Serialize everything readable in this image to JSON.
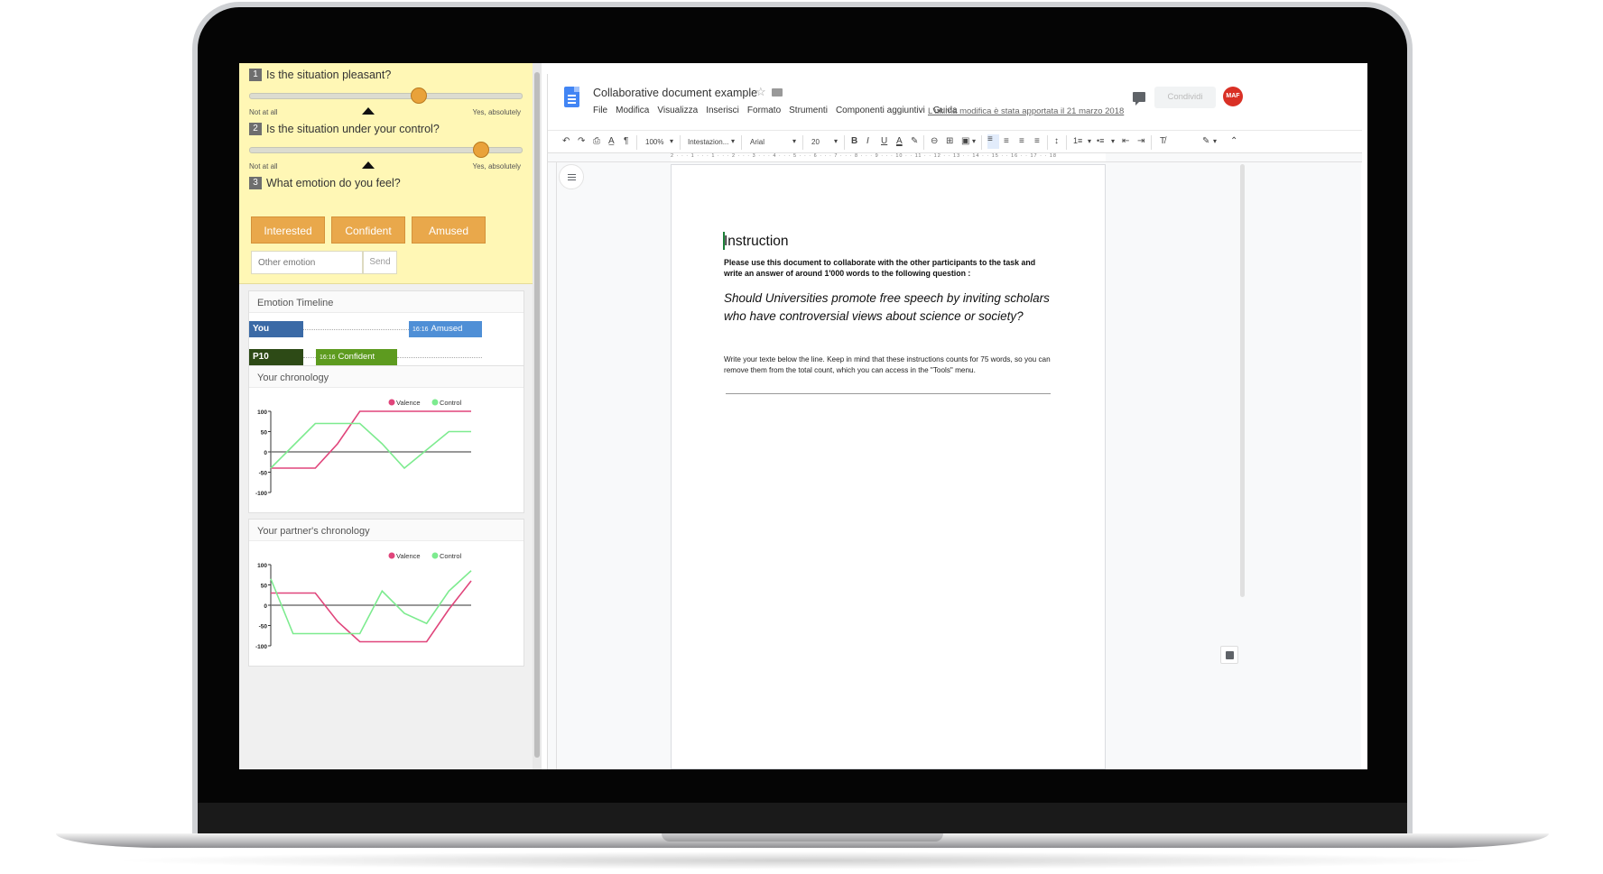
{
  "survey": {
    "q1": {
      "num": "1",
      "text": "Is the situation pleasant?",
      "min_label": "Not at all",
      "max_label": "Yes, absolutely",
      "value": 0.62
    },
    "q2": {
      "num": "2",
      "text": "Is the situation under your control?",
      "min_label": "Not at all",
      "max_label": "Yes, absolutely",
      "value": 0.85
    },
    "q3": {
      "num": "3",
      "text": "What emotion do you feel?"
    },
    "emotions": [
      "Interested",
      "Confident",
      "Amused"
    ],
    "other_placeholder": "Other emotion",
    "send_label": "Send"
  },
  "timeline": {
    "title": "Emotion Timeline",
    "rows": [
      {
        "participant": "You",
        "time": "16:16",
        "emotion": "Amused",
        "color": "#3b6aa6",
        "tag_color": "#4f8fd6"
      },
      {
        "participant": "P10",
        "time": "16:16",
        "emotion": "Confident",
        "color": "#2d4a16",
        "tag_color": "#5d9b1f"
      }
    ],
    "scroll_left": "◀",
    "scroll_right": "▶"
  },
  "charts": {
    "own_title": "Your chronology",
    "partner_title": "Your partner's chronology",
    "valence_color": "#e0457b",
    "control_color": "#7deb8f"
  },
  "chart_data": [
    {
      "type": "line",
      "title": "Your chronology",
      "ylim": [
        -100,
        100
      ],
      "yticks": [
        "100",
        "50",
        "0",
        "-50",
        "-100"
      ],
      "x": [
        0,
        1,
        2,
        3,
        4,
        5,
        6,
        7,
        8,
        9
      ],
      "series": [
        {
          "name": "Valence",
          "values": [
            -40,
            -40,
            -40,
            20,
            100,
            100,
            100,
            100,
            100,
            100
          ]
        },
        {
          "name": "Control",
          "values": [
            -40,
            15,
            70,
            70,
            70,
            20,
            -40,
            5,
            50,
            50
          ]
        }
      ]
    },
    {
      "type": "line",
      "title": "Your partner's chronology",
      "ylim": [
        -100,
        100
      ],
      "yticks": [
        "100",
        "50",
        "0",
        "-50",
        "-100"
      ],
      "x": [
        0,
        1,
        2,
        3,
        4,
        5,
        6,
        7,
        8,
        9
      ],
      "series": [
        {
          "name": "Valence",
          "values": [
            30,
            30,
            30,
            -40,
            -90,
            -90,
            -90,
            -90,
            -10,
            60
          ]
        },
        {
          "name": "Control",
          "values": [
            65,
            -70,
            -70,
            -70,
            -70,
            35,
            -20,
            -45,
            35,
            85
          ]
        }
      ]
    }
  ],
  "gdocs": {
    "title": "Collaborative document example",
    "star": "☆",
    "menu": [
      "File",
      "Modifica",
      "Visualizza",
      "Inserisci",
      "Formato",
      "Strumenti",
      "Componenti aggiuntivi",
      "Guida"
    ],
    "last_edit": "L'ultima modifica è stata apportata il 21 marzo 2018",
    "share_label": "Condividi",
    "avatar": "MAF",
    "toolbar": {
      "undo": "↶",
      "redo": "↷",
      "print": "⎙",
      "spell": "A̲",
      "paint": "¶",
      "zoom": "100%",
      "style": "Intestazion...",
      "font": "Arial",
      "size": "20",
      "bold": "B",
      "italic": "I",
      "underline": "U",
      "text_color": "A",
      "link": "⊖",
      "comment": "⊞",
      "image": "▣",
      "line_spacing": "↕",
      "numbered": "1≡",
      "bulleted": "•≡",
      "clear": "T̸",
      "edit": "✎",
      "collapse": "⌃"
    },
    "ruler": "2 · · · 1 · · · 1 · · · 2 · · · 3 · · · 4 · · · 5 · · · 6 · · · 7 · · · 8 · · · 9 · · · 10 · · 11 · · 12 · · 13 · · 14 · · 15 · · 16 · · 17 · · 18"
  },
  "document": {
    "heading": "Instruction",
    "bold_text": "Please use this document to collaborate with the other participants to the task and write an answer of around 1'000 words to the following question :",
    "question": "Should Universities promote free speech by inviting scholars who have controversial views about science or society?",
    "small_text": "Write your texte below the line. Keep in mind that these instructions counts for 75 words, so you can remove them from the total count, which you can access in the \"Tools\" menu."
  }
}
